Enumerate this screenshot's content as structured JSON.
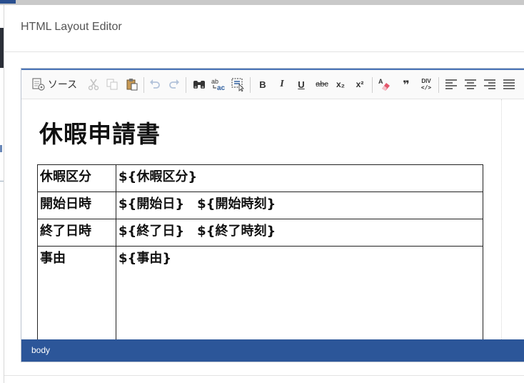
{
  "dialog": {
    "title": "HTML Layout Editor"
  },
  "toolbar": {
    "source_label": "ソース",
    "buttons": [
      "source-icon",
      "cut-icon",
      "copy-icon",
      "paste-icon",
      "undo-icon",
      "redo-icon",
      "find-icon",
      "replace-icon",
      "select-all-icon",
      "bold-icon",
      "italic-icon",
      "underline-icon",
      "strikethrough-icon",
      "subscript-icon",
      "superscript-icon",
      "remove-format-icon",
      "blockquote-icon",
      "div-icon",
      "align-left-icon",
      "align-center-icon",
      "align-right-icon",
      "justify-icon"
    ],
    "bold": "B",
    "italic": "I",
    "underline": "U",
    "strike": "abc",
    "subscript": "x₂",
    "superscript": "x²",
    "quote": "❞",
    "div": "DIV"
  },
  "document": {
    "title": "休暇申請書",
    "rows": [
      {
        "label": "休暇区分",
        "value": "${休暇区分}"
      },
      {
        "label": "開始日時",
        "value": "${開始日}　${開始時刻}"
      },
      {
        "label": "終了日時",
        "value": "${終了日}　${終了時刻}"
      },
      {
        "label": "事由",
        "value": "${事由}"
      }
    ]
  },
  "statusbar": {
    "path": "body"
  },
  "colors": {
    "accent": "#2c5699",
    "toolbar_bg": "#fafafa"
  }
}
